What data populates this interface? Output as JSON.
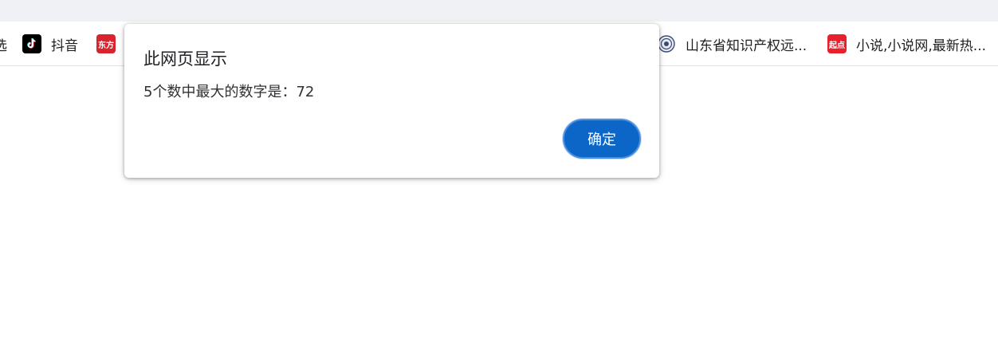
{
  "bookmarks": [
    {
      "label": "选",
      "icon": "none"
    },
    {
      "label": "抖音",
      "icon": "tiktok-icon"
    },
    {
      "label": "",
      "icon": "dongfang-icon",
      "icon_text": "东方"
    },
    {
      "label": "山东省知识产权远...",
      "icon": "gov-emblem-icon"
    },
    {
      "label": "小说,小说网,最新热...",
      "icon": "qidian-icon",
      "icon_text": "起点"
    }
  ],
  "dialog": {
    "title": "此网页显示",
    "message": "5个数中最大的数字是：72",
    "ok_label": "确定"
  },
  "colors": {
    "accent": "#0b66c8",
    "top_strip": "#f0f1f4"
  }
}
